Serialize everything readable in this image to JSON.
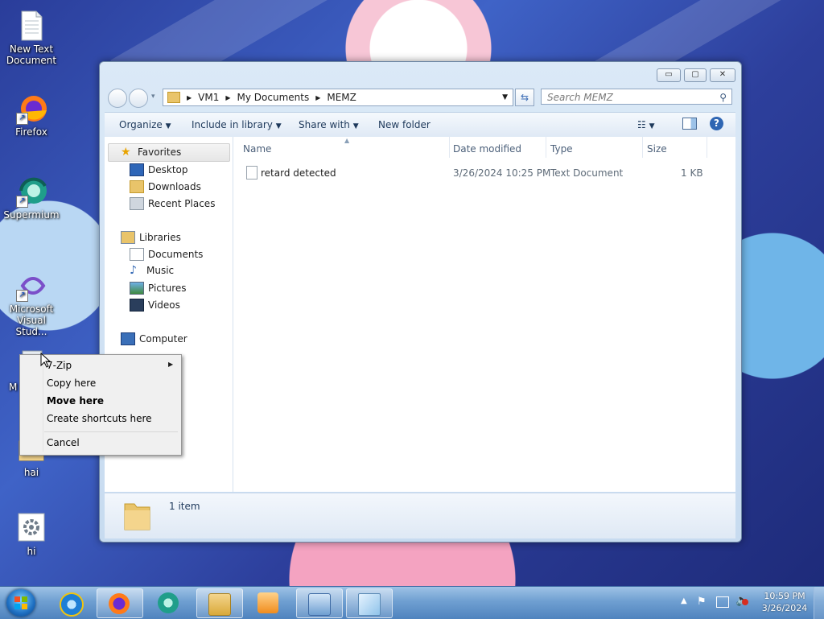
{
  "desktop": {
    "icons": [
      {
        "label": "New Text Document",
        "icon": "text-document-icon"
      },
      {
        "label": "Firefox",
        "icon": "firefox-icon"
      },
      {
        "label": "Supermium",
        "icon": "supermium-icon"
      },
      {
        "label": "Microsoft Visual Stud...",
        "icon": "visual-studio-icon"
      },
      {
        "label": "M",
        "icon": "program-icon"
      },
      {
        "label": "hai",
        "icon": "folder-icon"
      },
      {
        "label": "hi",
        "icon": "settings-file-icon"
      }
    ]
  },
  "explorer": {
    "caption_buttons": {
      "minimize": "▭",
      "maximize": "▢",
      "close": "✕"
    },
    "breadcrumb": [
      "VM1",
      "My Documents",
      "MEMZ"
    ],
    "search_placeholder": "Search MEMZ",
    "toolbar": {
      "organize": "Organize",
      "include_in_library": "Include in library",
      "share_with": "Share with",
      "new_folder": "New folder"
    },
    "nav": {
      "favorites": {
        "label": "Favorites",
        "items": [
          "Desktop",
          "Downloads",
          "Recent Places"
        ]
      },
      "libraries": {
        "label": "Libraries",
        "items": [
          "Documents",
          "Music",
          "Pictures",
          "Videos"
        ]
      },
      "computer": {
        "label": "Computer"
      }
    },
    "columns": [
      "Name",
      "Date modified",
      "Type",
      "Size"
    ],
    "files": [
      {
        "name": "retard detected",
        "date_modified": "3/26/2024 10:25 PM",
        "type": "Text Document",
        "size": "1 KB"
      }
    ],
    "details": {
      "count": "1 item"
    }
  },
  "context_menu": {
    "items": [
      "7-Zip",
      "Copy here",
      "Move here",
      "Create shortcuts here",
      "Cancel"
    ],
    "default_item": "Move here"
  },
  "taskbar": {
    "pinned": [
      "internet-explorer-icon",
      "firefox-icon",
      "supermium-icon",
      "windows-explorer-icon",
      "media-player-icon",
      "control-panel-icon",
      "notepad-icon"
    ],
    "clock": {
      "time": "10:59 PM",
      "date": "3/26/2024"
    }
  },
  "colors": {
    "accent": "#3b6cb5",
    "taskbar": "#6f9fd1",
    "window_frame": "#c7dbf0"
  }
}
